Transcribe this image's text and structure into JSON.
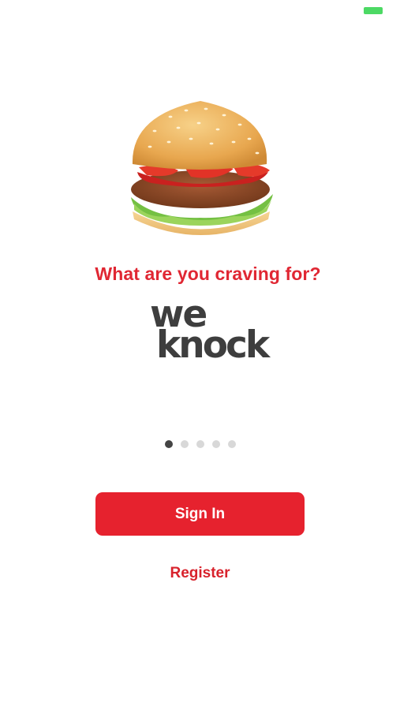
{
  "status_bar": {
    "battery_color": "#4cd964"
  },
  "onboarding": {
    "image": "burger-illustration",
    "tagline": "What are you craving for?",
    "logo": {
      "line1": "we",
      "line2": "knock"
    },
    "pager": {
      "total": 5,
      "active": 0
    }
  },
  "actions": {
    "sign_in_label": "Sign In",
    "register_label": "Register"
  },
  "colors": {
    "brand_red": "#e6222e",
    "text_red": "#e02733",
    "logo_gray": "#3e3e3e"
  }
}
